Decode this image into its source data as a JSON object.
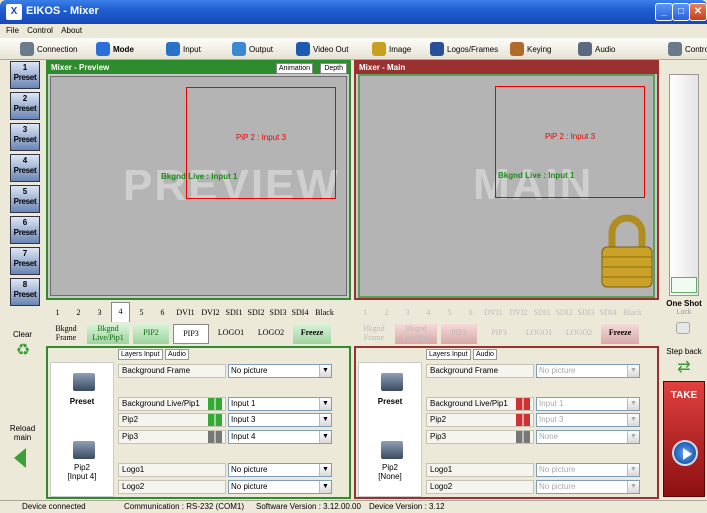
{
  "window": {
    "title": "EIKOS - Mixer",
    "logo_glyph": "X"
  },
  "menu": [
    "File",
    "Control",
    "About"
  ],
  "toolbar": [
    {
      "label": "Connection",
      "icon": "connection-icon",
      "color": "#6b7b8c"
    },
    {
      "label": "Mode",
      "icon": "mode-icon",
      "color": "#2b6fd8"
    },
    {
      "label": "Input",
      "icon": "input-icon",
      "color": "#2a72c8"
    },
    {
      "label": "Output",
      "icon": "output-icon",
      "color": "#3a8ad0"
    },
    {
      "label": "Video Out",
      "icon": "video-out-icon",
      "color": "#1d5bb2"
    },
    {
      "label": "Image",
      "icon": "image-icon",
      "color": "#c8a020"
    },
    {
      "label": "Logos/Frames",
      "icon": "logos-frames-icon",
      "color": "#2a4f99"
    },
    {
      "label": "Keying",
      "icon": "keying-icon",
      "color": "#b06a2a"
    },
    {
      "label": "Audio",
      "icon": "audio-icon",
      "color": "#5a6a80"
    },
    {
      "label": "Control",
      "icon": "control-icon",
      "color": "#6a7a8a"
    }
  ],
  "presets": [
    {
      "num": "1",
      "label": "Preset"
    },
    {
      "num": "2",
      "label": "Preset"
    },
    {
      "num": "3",
      "label": "Preset"
    },
    {
      "num": "4",
      "label": "Preset"
    },
    {
      "num": "5",
      "label": "Preset"
    },
    {
      "num": "6",
      "label": "Preset"
    },
    {
      "num": "7",
      "label": "Preset"
    },
    {
      "num": "8",
      "label": "Preset"
    }
  ],
  "left_actions": {
    "clear": "Clear",
    "reload": "Reload\nmain"
  },
  "preview": {
    "title": "Mixer - Preview",
    "tabs": [
      "Animation",
      "Depth"
    ],
    "watermark": "PREVIEW",
    "pip_label": "PiP 2 : Input 3",
    "bkgnd_label": "Bkgnd Live : Input 1",
    "sources": [
      "1",
      "2",
      "3",
      "4",
      "5",
      "6",
      "DVI1",
      "DVI2",
      "SDI1",
      "SDI2",
      "SDI3",
      "SDI4",
      "Black"
    ],
    "layers": [
      "Bkgnd Frame",
      "Bkgnd Live/Pip1",
      "PIP2",
      "PIP3",
      "LOGO1",
      "LOGO2",
      "Freeze"
    ],
    "panel_tabs": [
      "Layers Input",
      "Audio"
    ],
    "preset_label": "Preset",
    "pip_info": "Pip2\n[Input 4]",
    "rows": [
      {
        "name": "Background Frame",
        "value": "No picture"
      },
      {
        "name": "Background Live/Pip1",
        "value": "Input 1"
      },
      {
        "name": "Pip2",
        "value": "Input 3"
      },
      {
        "name": "Pip3",
        "value": "Input 4"
      },
      {
        "name": "Logo1",
        "value": "No picture"
      },
      {
        "name": "Logo2",
        "value": "No picture"
      }
    ]
  },
  "main": {
    "title": "Mixer - Main",
    "watermark": "MAIN",
    "pip_label": "PiP 2 : Input 3",
    "bkgnd_label": "Bkgnd Live : Input 1",
    "sources": [
      "1",
      "2",
      "3",
      "4",
      "5",
      "6",
      "DVI1",
      "DVI2",
      "SDI1",
      "SDI2",
      "SDI3",
      "SDI4",
      "Black"
    ],
    "layers": [
      "Bkgnd Frame",
      "Bkgnd Live/Pip1",
      "PIP2",
      "PIP3",
      "LOGO1",
      "LOGO2",
      "Freeze"
    ],
    "panel_tabs": [
      "Layers Input",
      "Audio"
    ],
    "preset_label": "Preset",
    "pip_info": "Pip2\n[None]",
    "rows": [
      {
        "name": "Background Frame",
        "value": "No picture"
      },
      {
        "name": "Background Live/Pip1",
        "value": "Input 1"
      },
      {
        "name": "Pip2",
        "value": "Input 3"
      },
      {
        "name": "Pip3",
        "value": "None"
      },
      {
        "name": "Logo1",
        "value": "No picture"
      },
      {
        "name": "Logo2",
        "value": "No picture"
      }
    ]
  },
  "right": {
    "one_shot": "One Shot",
    "lock": "Lock",
    "step_back": "Step back",
    "take": "TAKE"
  },
  "status": {
    "conn": "Device connected",
    "comm": "Communication : RS-232 (COM1)",
    "sw": "Software Version : 3.12.00.00",
    "dev": "Device Version : 3.12"
  }
}
